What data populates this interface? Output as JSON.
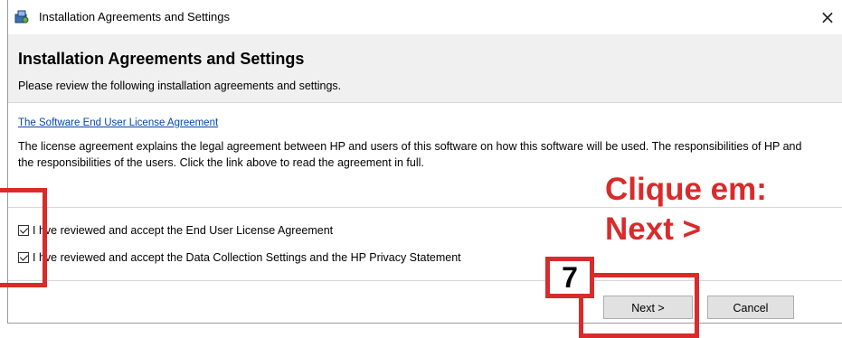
{
  "window": {
    "title": "Installation Agreements and Settings",
    "close_glyph": "×",
    "app_icon": "installer-icon"
  },
  "header": {
    "title": "Installation Agreements and Settings",
    "subtitle": "Please review the following installation agreements and settings."
  },
  "body": {
    "eula_link": "The Software End User License Agreement",
    "description": "The license agreement explains the legal agreement between HP and users of this software on how this software will be used. The responsibilities of HP and the responsibilities of the users. Click the link above to read the agreement in full."
  },
  "checks": [
    {
      "prefix": "I h",
      "suffix": "ve reviewed and accept the End User License Agreement",
      "checked": true
    },
    {
      "prefix": "I h",
      "suffix": "ve reviewed and accept the Data Collection Settings and the HP Privacy Statement",
      "checked": true
    }
  ],
  "buttons": {
    "next": "Next >",
    "cancel": "Cancel"
  },
  "annotation": {
    "step_number": "7",
    "tip_line1": "Clique em:",
    "tip_line2": "Next >",
    "color": "#d92b2b"
  }
}
